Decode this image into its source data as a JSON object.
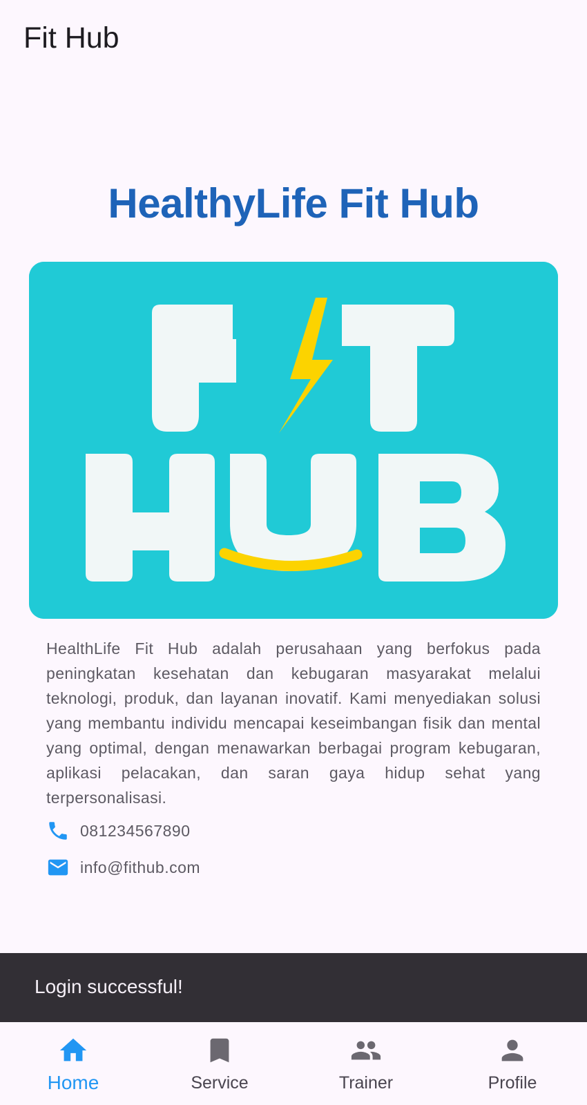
{
  "appbar": {
    "title": "Fit Hub"
  },
  "main": {
    "heading": "HealthyLife Fit Hub",
    "logo": {
      "text_line1": "FIT",
      "text_line2": "HUB",
      "background": "#20cad6",
      "letter_color": "#f1f7f7",
      "accent_color": "#fcd300"
    },
    "description": "HealthLife Fit Hub adalah perusahaan yang berfokus pada peningkatan kesehatan dan kebugaran masyarakat melalui teknologi, produk, dan layanan inovatif. Kami menyediakan solusi yang membantu individu mencapai keseimbangan fisik dan mental yang optimal, dengan menawarkan berbagai program kebugaran, aplikasi pelacakan, dan saran gaya hidup sehat yang terpersonalisasi.",
    "contacts": {
      "phone": {
        "icon": "phone-icon",
        "value": "081234567890"
      },
      "email": {
        "icon": "email-icon",
        "value": "info@fithub.com"
      }
    }
  },
  "snackbar": {
    "message": "Login successful!"
  },
  "bottom_nav": {
    "active_color": "#2196f3",
    "inactive_color": "#49454f",
    "items": [
      {
        "label": "Home",
        "icon": "home-icon",
        "active": true
      },
      {
        "label": "Service",
        "icon": "bookmark-icon",
        "active": false
      },
      {
        "label": "Trainer",
        "icon": "people-icon",
        "active": false
      },
      {
        "label": "Profile",
        "icon": "person-icon",
        "active": false
      }
    ]
  }
}
